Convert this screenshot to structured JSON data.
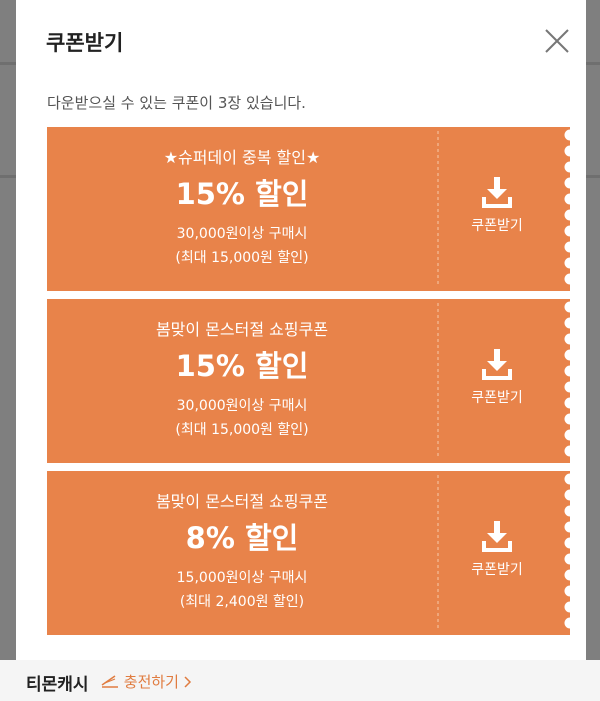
{
  "modal": {
    "title": "쿠폰받기",
    "subtitle": "다운받으실 수 있는 쿠폰이 3장 있습니다."
  },
  "coupons": [
    {
      "title": "★슈퍼데이 중복 할인★",
      "amount": "15% 할인",
      "condition": "30,000원이상 구매시",
      "max": "(최대 15,000원 할인)",
      "download_label": "쿠폰받기",
      "percent": 15
    },
    {
      "title": "봄맞이 몬스터절 쇼핑쿠폰",
      "amount": "15% 할인",
      "condition": "30,000원이상 구매시",
      "max": "(최대 15,000원 할인)",
      "download_label": "쿠폰받기",
      "percent": 15
    },
    {
      "title": "봄맞이 몬스터절 쇼핑쿠폰",
      "amount": "8% 할인",
      "condition": "15,000원이상 구매시",
      "max": "(최대 2,400원 할인)",
      "download_label": "쿠폰받기",
      "percent": 8
    }
  ],
  "bottom_bar": {
    "brand": "티몬캐시",
    "charge_label": "충전하기"
  },
  "colors": {
    "coupon_bg": "#e8834a",
    "overlay": "#7f7f7f",
    "modal_bg": "#ffffff"
  },
  "icons": {
    "close": "close-icon",
    "download": "download-icon",
    "coin": "coin-stack-icon",
    "chevron": "chevron-right-icon"
  }
}
